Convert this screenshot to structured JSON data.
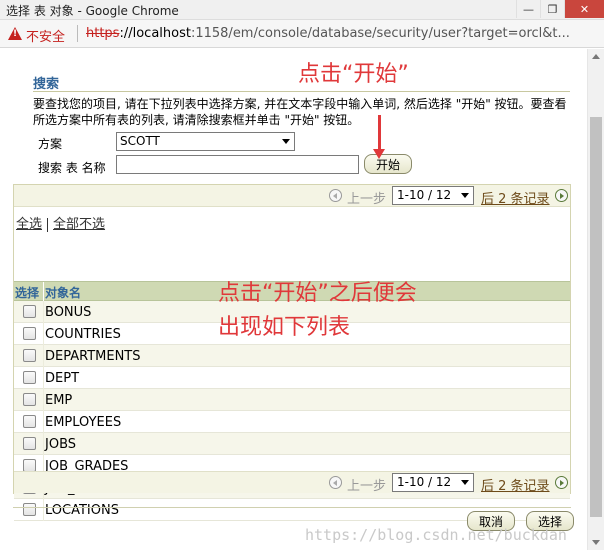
{
  "window": {
    "title": "选择 表 对象 - Google Chrome",
    "minimize": "—",
    "maximize": "❐",
    "close": "✕"
  },
  "address_bar": {
    "security_label": "不安全",
    "url_scheme": "https",
    "url_rest_host": "://localhost",
    "url_path": ":1158/em/console/database/security/user?target=orcl&t..."
  },
  "search": {
    "heading": "搜索",
    "instructions": "要查找您的项目, 请在下拉列表中选择方案, 并在文本字段中输入单词, 然后选择 \"开始\" 按钮。要查看所选方案中所有表的列表, 请清除搜索框并单击 \"开始\" 按钮。",
    "schema_label": "方案",
    "schema_value": "SCOTT",
    "search_label": "搜索 表 名称",
    "search_value": "",
    "go_button": "开始"
  },
  "annotations": {
    "click_go": "点击“开始”",
    "after_go_line1": "点击“开始”之后便会",
    "after_go_line2": "出现如下列表"
  },
  "pagination": {
    "prev_label": "上一步",
    "range_value": "1-10 / 12",
    "next_label": "后 2 条记录"
  },
  "selection": {
    "select_all": "全选",
    "select_none": "全部不选"
  },
  "table": {
    "headers": [
      "选择",
      "对象名"
    ],
    "rows": [
      {
        "name": "BONUS"
      },
      {
        "name": "COUNTRIES"
      },
      {
        "name": "DEPARTMENTS"
      },
      {
        "name": "DEPT"
      },
      {
        "name": "EMP"
      },
      {
        "name": "EMPLOYEES"
      },
      {
        "name": "JOBS"
      },
      {
        "name": "JOB_GRADES"
      },
      {
        "name": "JOB_HISTORY"
      },
      {
        "name": "LOCATIONS"
      }
    ]
  },
  "footer": {
    "cancel_button": "取消",
    "select_button": "选择"
  },
  "watermark": "https://blog.csdn.net/buckdan"
}
